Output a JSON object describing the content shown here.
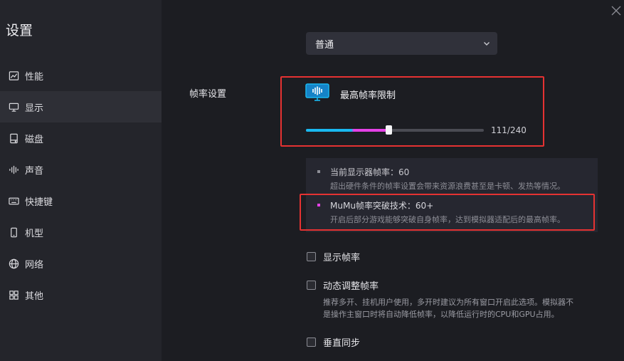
{
  "sidebar": {
    "title": "设置",
    "items": [
      {
        "label": "性能",
        "icon": "chart-line-icon"
      },
      {
        "label": "显示",
        "icon": "monitor-icon"
      },
      {
        "label": "磁盘",
        "icon": "disk-icon"
      },
      {
        "label": "声音",
        "icon": "audio-icon"
      },
      {
        "label": "快捷键",
        "icon": "keyboard-icon"
      },
      {
        "label": "机型",
        "icon": "phone-icon"
      },
      {
        "label": "网络",
        "icon": "globe-icon"
      },
      {
        "label": "其他",
        "icon": "grid-icon"
      }
    ],
    "active_index": 1
  },
  "display": {
    "mode_select_value": "普通",
    "framerate_section_label": "帧率设置",
    "max_framerate_title": "最高帧率限制",
    "slider": {
      "value": 111,
      "max": 240,
      "value_text": "111/240"
    },
    "info": {
      "current_title": "当前显示器帧率：60",
      "current_desc": "超出硬件条件的帧率设置会带来资源浪费甚至是卡顿、发热等情况。",
      "mumu_title": "MuMu帧率突破技术：60+",
      "mumu_desc": "开启后部分游戏能够突破自身帧率，达到模拟器适配后的最高帧率。"
    },
    "options": {
      "show_fps_label": "显示帧率",
      "dynamic_fps_label": "动态调整帧率",
      "dynamic_fps_desc_1": "推荐多开、挂机用户使用，多开时建议为所有窗口开启此选项。模拟器不",
      "dynamic_fps_desc_2": "是操作主窗口时将自动降低帧率，以降低运行时的CPU和GPU占用。",
      "vsync_label": "垂直同步"
    }
  },
  "colors": {
    "accent_blue": "#19b8f0",
    "accent_magenta": "#e541e6",
    "highlight_red": "#e53232"
  }
}
